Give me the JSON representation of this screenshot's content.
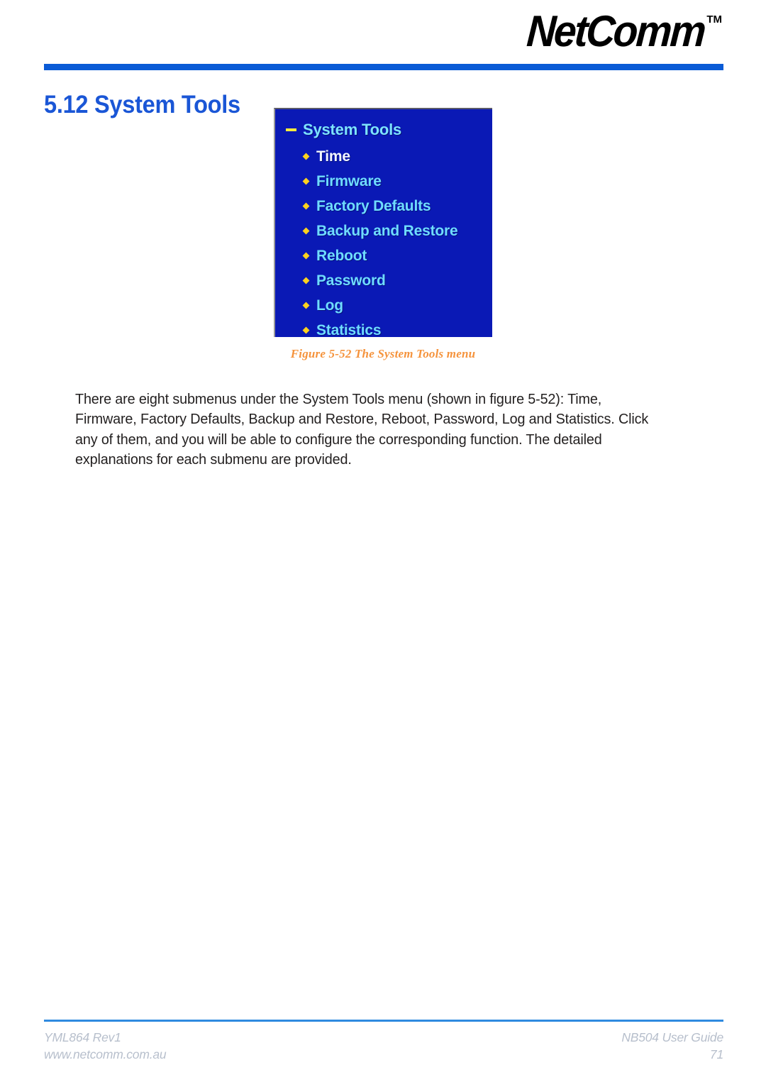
{
  "header": {
    "logo_text": "NetComm",
    "logo_trademark": "TM"
  },
  "heading": {
    "number": "5.12",
    "title": "System Tools",
    "full": "5.12 System Tools"
  },
  "figure": {
    "caption": "Figure 5-52 The System Tools menu",
    "screenshot": {
      "root_label": "System Tools",
      "root_toggle_icon": "minus-icon",
      "background_color": "#0a19b5",
      "link_color": "#6fdcff",
      "active_link_color": "#f2f6ff",
      "bullet_color": "#ffd21e",
      "items": [
        {
          "label": "Time",
          "active": true
        },
        {
          "label": "Firmware",
          "active": false
        },
        {
          "label": "Factory Defaults",
          "active": false
        },
        {
          "label": "Backup and Restore",
          "active": false
        },
        {
          "label": "Reboot",
          "active": false
        },
        {
          "label": "Password",
          "active": false
        },
        {
          "label": "Log",
          "active": false
        },
        {
          "label": "Statistics",
          "active": false
        }
      ]
    }
  },
  "body": {
    "paragraph": "There are eight submenus under the System Tools menu (shown in figure 5-52): Time, Firmware, Factory Defaults, Backup and Restore, Reboot, Password, Log and Statistics. Click any of them, and you will be able to configure the corresponding function. The detailed explanations for each submenu are provided."
  },
  "footer": {
    "doc_code": "YML864 Rev1",
    "website": "www.netcomm.com.au",
    "guide_title": "NB504 User Guide",
    "page_number": "71"
  },
  "colors": {
    "brand_blue": "#0a5bd6",
    "heading_blue": "#1a56d6",
    "caption_orange": "#f5933c",
    "footer_gray": "#b7bfcc",
    "ui_blue": "#0a19b5"
  }
}
